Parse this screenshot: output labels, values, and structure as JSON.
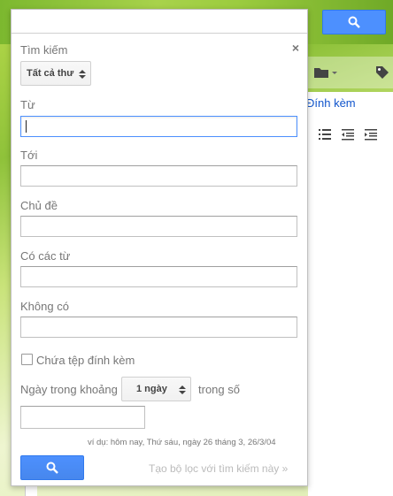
{
  "search_panel": {
    "title": "Tìm kiếm",
    "close_glyph": "×",
    "scope_select": {
      "selected": "Tất cả thư"
    },
    "fields": {
      "from_label": "Từ",
      "from_value": "",
      "to_label": "Tới",
      "to_value": "",
      "subject_label": "Chủ đề",
      "subject_value": "",
      "has_words_label": "Có các từ",
      "has_words_value": "",
      "doesnt_have_label": "Không có",
      "doesnt_have_value": ""
    },
    "has_attachment_label": "Chứa tệp đính kèm",
    "has_attachment_checked": false,
    "date_within_label": "Ngày trong khoảng",
    "date_within_select": "1 ngày",
    "within_of_label": "trong số",
    "date_value": "",
    "example_text": "ví dụ: hôm nay, Thứ sáu, ngày 26 tháng 3, 26/3/04",
    "create_filter_link": "Tạo bộ lọc với tìm kiếm này »",
    "search_icon": "search-icon"
  },
  "background": {
    "attach_link_text": "Đính kèm",
    "icons": [
      "search-icon",
      "folder-icon",
      "tag-icon",
      "bulleted-list-icon",
      "indent-less-icon",
      "indent-more-icon"
    ]
  },
  "colors": {
    "accent_blue": "#4d90fe",
    "link_blue": "#1155cc",
    "label_gray": "#777777"
  }
}
